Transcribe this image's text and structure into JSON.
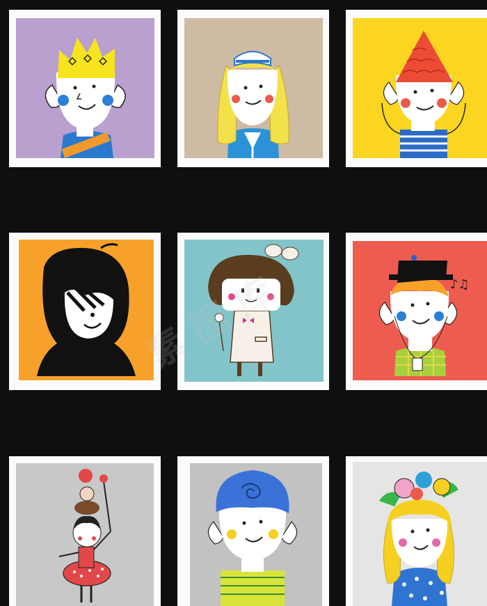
{
  "watermark": "素 图 库"
}
